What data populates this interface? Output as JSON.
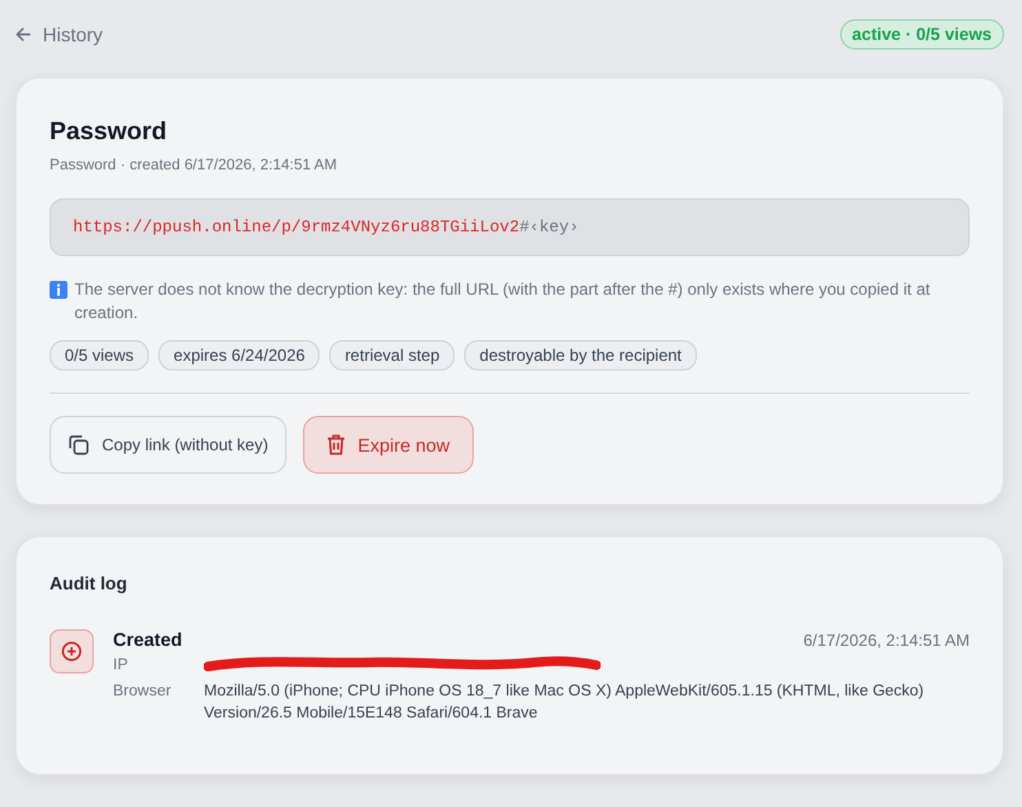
{
  "header": {
    "back_label": "History",
    "status_badge": "active · 0/5 views"
  },
  "secret": {
    "title": "Password",
    "subtitle": "Password · created 6/17/2026, 2:14:51 AM",
    "url": "https://ppush.online/p/9rmz4VNyz6ru88TGiiLov2",
    "url_suffix": "#‹key›",
    "note": "The server does not know the decryption key: the full URL (with the part after the #) only exists where you copied it at creation.",
    "tags": [
      "0/5 views",
      "expires 6/24/2026",
      "retrieval step",
      "destroyable by the recipient"
    ],
    "actions": [
      {
        "kind": "copy",
        "label": "Copy link (without key)"
      },
      {
        "kind": "expire",
        "label": "Expire now"
      }
    ]
  },
  "audit_log": {
    "title": "Audit log",
    "entries": [
      {
        "kind": "created",
        "event": "Created",
        "time": "6/17/2026, 2:14:51 AM",
        "fields": [
          {
            "kind": "redacted",
            "label": "IP"
          },
          {
            "kind": "text",
            "label": "Browser",
            "value": "Mozilla/5.0 (iPhone; CPU iPhone OS 18_7 like Mac OS X) AppleWebKit/605.1.15 (KHTML, like Gecko) Version/26.5 Mobile/15E148 Safari/604.1 Brave"
          }
        ]
      }
    ]
  }
}
